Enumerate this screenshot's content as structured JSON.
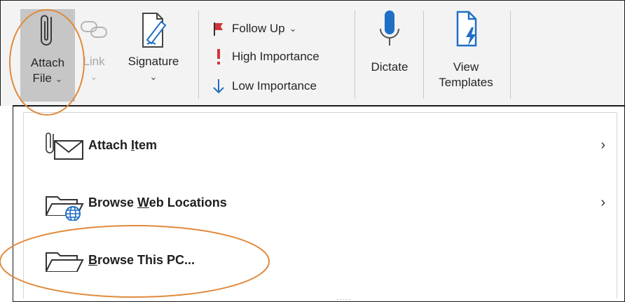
{
  "ribbon": {
    "attach_file": {
      "line1": "Attach",
      "line2": "File",
      "caret": "⌄"
    },
    "link": {
      "label": "Link",
      "caret": "⌄"
    },
    "signature": {
      "label": "Signature",
      "caret": "⌄"
    },
    "follow_up": {
      "label": "Follow Up",
      "caret": "⌄"
    },
    "high_importance": {
      "label": "High Importance"
    },
    "low_importance": {
      "label": "Low Importance"
    },
    "dictate": {
      "label": "Dictate"
    },
    "view_templates": {
      "line1": "View",
      "line2": "Templates"
    }
  },
  "menu": {
    "items": [
      {
        "prefix": "Attach ",
        "accel": "I",
        "suffix": "tem",
        "icon": "attach-item-icon",
        "has_submenu": true
      },
      {
        "prefix": "Browse ",
        "accel": "W",
        "suffix": "eb Locations",
        "icon": "web-folder-icon",
        "has_submenu": true
      },
      {
        "prefix": "",
        "accel": "B",
        "suffix": "rowse This PC...",
        "icon": "folder-icon",
        "has_submenu": false
      }
    ],
    "submenu_chevron": "›",
    "grip": "....."
  },
  "colors": {
    "annotation": "#e08a3c",
    "flag_red": "#d13438",
    "accent_blue": "#1f6fc4",
    "ribbon_bg": "#f3f3f3",
    "pressed_bg": "#c6c6c6"
  }
}
